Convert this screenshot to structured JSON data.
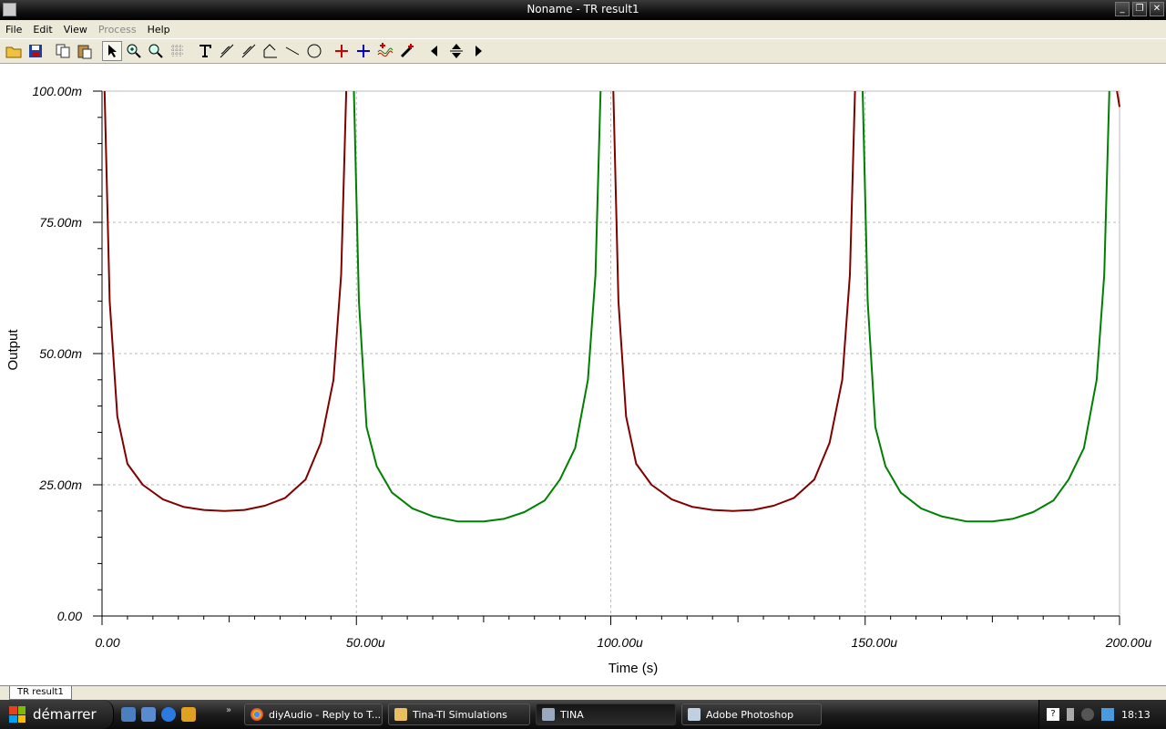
{
  "window": {
    "title": "Noname - TR result1",
    "controls": [
      "_",
      "❐",
      "✕"
    ]
  },
  "menu": [
    {
      "label": "File",
      "disabled": false
    },
    {
      "label": "Edit",
      "disabled": false
    },
    {
      "label": "View",
      "disabled": false
    },
    {
      "label": "Process",
      "disabled": true
    },
    {
      "label": "Help",
      "disabled": false
    }
  ],
  "toolbar": {
    "icons": [
      "open-folder-icon",
      "save-icon",
      "copy-icon",
      "paste-icon",
      "pointer-icon",
      "zoom-in-icon",
      "zoom-100-icon",
      "grid-icon",
      "text-tool-icon",
      "cursor-a-icon",
      "cursor-b-icon",
      "axis-icon",
      "line-tool-icon",
      "circle-tool-icon",
      "marker-a-icon",
      "marker-b-icon",
      "waveform-icon",
      "probe-icon",
      "pan-left-icon",
      "pan-updown-icon",
      "pan-right-icon"
    ]
  },
  "chart_data": {
    "type": "line",
    "title": "",
    "xlabel": "Time (s)",
    "ylabel": "Output",
    "xlim": [
      0,
      0.0002
    ],
    "ylim": [
      0,
      0.1
    ],
    "x_tick_labels": [
      "0.00",
      "50.00u",
      "100.00u",
      "150.00u",
      "200.00u"
    ],
    "y_tick_labels": [
      "0.00",
      "25.00m",
      "50.00m",
      "75.00m",
      "100.00m"
    ],
    "grid": true,
    "series": [
      {
        "color": "#800000",
        "segments": [
          {
            "x": [
              5e-07,
              1.5e-06,
              3e-06,
              5e-06,
              8e-06,
              1.2e-05,
              1.6e-05,
              2e-05,
              2.4e-05,
              2.8e-05,
              3.2e-05,
              3.6e-05,
              4e-05,
              4.3e-05,
              4.55e-05,
              4.7e-05,
              4.8e-05
            ],
            "y": [
              0.1,
              0.06,
              0.038,
              0.029,
              0.025,
              0.0222,
              0.0208,
              0.0202,
              0.02,
              0.0202,
              0.021,
              0.0225,
              0.026,
              0.033,
              0.045,
              0.065,
              0.1
            ]
          },
          {
            "x": [
              0.0001005,
              0.0001015,
              0.000103,
              0.000105,
              0.000108,
              0.000112,
              0.000116,
              0.00012,
              0.000124,
              0.000128,
              0.000132,
              0.000136,
              0.00014,
              0.000143,
              0.0001455,
              0.000147,
              0.000148
            ],
            "y": [
              0.1,
              0.06,
              0.038,
              0.029,
              0.025,
              0.0222,
              0.0208,
              0.0202,
              0.02,
              0.0202,
              0.021,
              0.0225,
              0.026,
              0.033,
              0.045,
              0.065,
              0.1
            ]
          },
          {
            "x": [
              0.0001995,
              0.0002
            ],
            "y": [
              0.1,
              0.097
            ]
          }
        ]
      },
      {
        "color": "#008000",
        "segments": [
          {
            "x": [
              4.95e-05,
              5.05e-05,
              5.2e-05,
              5.4e-05,
              5.7e-05,
              6.1e-05,
              6.5e-05,
              7e-05,
              7.5e-05,
              7.9e-05,
              8.3e-05,
              8.7e-05,
              9e-05,
              9.3e-05,
              9.55e-05,
              9.7e-05,
              9.8e-05
            ],
            "y": [
              0.1,
              0.06,
              0.036,
              0.0285,
              0.0235,
              0.0205,
              0.019,
              0.018,
              0.018,
              0.0185,
              0.0198,
              0.022,
              0.026,
              0.032,
              0.045,
              0.065,
              0.1
            ]
          },
          {
            "x": [
              0.0001495,
              0.0001505,
              0.000152,
              0.000154,
              0.000157,
              0.000161,
              0.000165,
              0.00017,
              0.000175,
              0.000179,
              0.000183,
              0.000187,
              0.00019,
              0.000193,
              0.0001955,
              0.000197,
              0.000198
            ],
            "y": [
              0.1,
              0.06,
              0.036,
              0.0285,
              0.0235,
              0.0205,
              0.019,
              0.018,
              0.018,
              0.0185,
              0.0198,
              0.022,
              0.026,
              0.032,
              0.045,
              0.065,
              0.1
            ]
          }
        ]
      }
    ]
  },
  "tabs": [
    {
      "label": "TR result1"
    }
  ],
  "taskbar": {
    "start_label": "démarrer",
    "tasks": [
      {
        "label": "diyAudio - Reply to T...",
        "active": false
      },
      {
        "label": "Tina-TI Simulations",
        "active": false
      },
      {
        "label": "TINA",
        "active": true
      },
      {
        "label": "Adobe Photoshop",
        "active": false
      }
    ],
    "clock": "18:13"
  }
}
